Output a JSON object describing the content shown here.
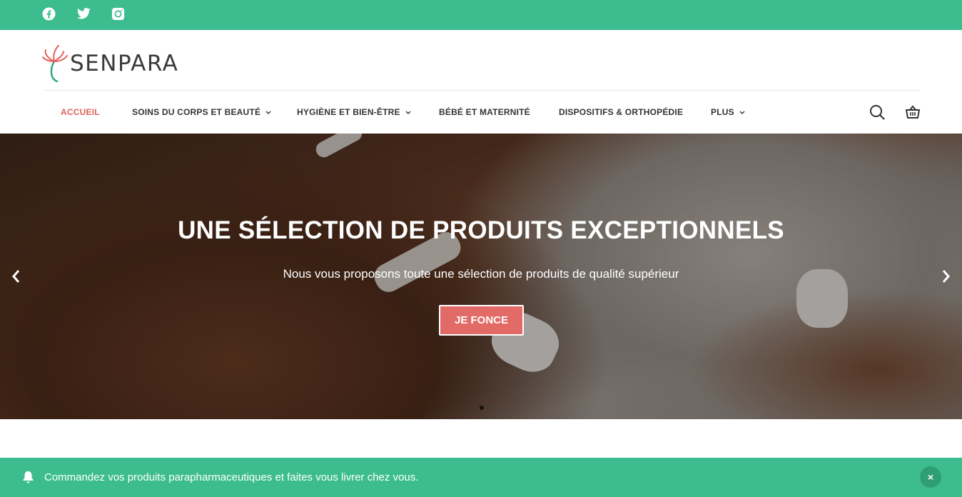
{
  "topbar": {
    "social": [
      {
        "icon": "facebook-icon"
      },
      {
        "icon": "twitter-icon"
      },
      {
        "icon": "instagram-icon"
      }
    ]
  },
  "brand": {
    "name": "SENPARA"
  },
  "nav": {
    "items": [
      {
        "label": "ACCUEIL",
        "active": true,
        "dropdown": false
      },
      {
        "label": "SOINS DU CORPS ET BEAUTÉ",
        "active": false,
        "dropdown": true
      },
      {
        "label": "HYGIÈNE ET BIEN-ÊTRE",
        "active": false,
        "dropdown": true
      },
      {
        "label": "BÉBÉ ET MATERNITÉ",
        "active": false,
        "dropdown": false
      },
      {
        "label": "DISPOSITIFS & ORTHOPÉDIE",
        "active": false,
        "dropdown": false
      },
      {
        "label": "PLUS",
        "active": false,
        "dropdown": true
      }
    ],
    "icons": [
      "search-icon",
      "cart-icon"
    ]
  },
  "hero": {
    "title": "UNE SÉLECTION DE PRODUITS EXCEPTIONNELS",
    "subtitle": "Nous vous proposons toute une sélection de produits de qualité supérieur",
    "button": "JE FONCE",
    "slides": 1,
    "active_slide": 0
  },
  "notice": {
    "text": "Commandez vos produits parapharmaceutiques et faites vous livrer chez vous.",
    "close": "×"
  },
  "colors": {
    "accent_green": "#3dbd8f",
    "accent_red": "#e26b67",
    "nav_active": "#e0605a",
    "text_dark": "#333333"
  }
}
